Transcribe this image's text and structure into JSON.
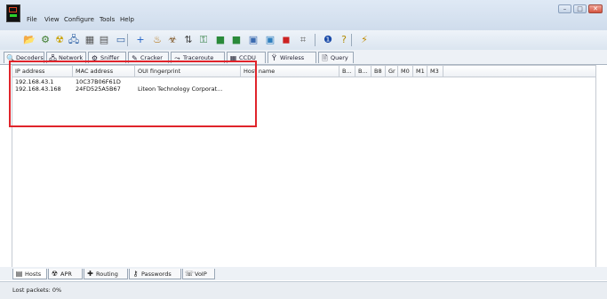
{
  "menu": [
    "File",
    "View",
    "Configure",
    "Tools",
    "Help"
  ],
  "window_controls": {
    "minimize": "–",
    "maximize": "□",
    "close": "✕"
  },
  "toolbar_icons": [
    {
      "name": "open-icon",
      "glyph": "📂",
      "color": "#d9a021"
    },
    {
      "name": "sniffer-start-icon",
      "glyph": "⚙",
      "color": "#3b7a2a"
    },
    {
      "name": "apr-icon",
      "glyph": "☢",
      "color": "#c9a100"
    },
    {
      "name": "network-icon",
      "glyph": "🖧",
      "color": "#3466a8"
    },
    {
      "name": "scan-icon",
      "glyph": "▦",
      "color": "#555"
    },
    {
      "name": "grid-icon",
      "glyph": "▤",
      "color": "#555"
    },
    {
      "name": "monitor-icon",
      "glyph": "▭",
      "color": "#2f5fa0"
    },
    {
      "name": "add-icon",
      "glyph": "+",
      "color": "#1a5cc4"
    },
    {
      "name": "hash-icon",
      "glyph": "♨",
      "color": "#b26a00"
    },
    {
      "name": "cracker-icon",
      "glyph": "☣",
      "color": "#7a4d1a"
    },
    {
      "name": "routing-icon",
      "glyph": "⇅",
      "color": "#444"
    },
    {
      "name": "certificate-icon",
      "glyph": "⚿",
      "color": "#2a7a3a"
    },
    {
      "name": "decoder-icon",
      "glyph": "■",
      "color": "#2a8a3a"
    },
    {
      "name": "voip-icon",
      "glyph": "■",
      "color": "#2a8a3a"
    },
    {
      "name": "calc-icon",
      "glyph": "▣",
      "color": "#3b6bb0"
    },
    {
      "name": "wireless-icon",
      "glyph": "▣",
      "color": "#2f7fbf"
    },
    {
      "name": "stop-icon",
      "glyph": "◼",
      "color": "#c22"
    },
    {
      "name": "query-icon",
      "glyph": "⌗",
      "color": "#666"
    },
    {
      "name": "help-icon",
      "glyph": "❶",
      "color": "#1a4aa8"
    },
    {
      "name": "question-icon",
      "glyph": "?",
      "color": "#b08a00"
    },
    {
      "name": "lightning-icon",
      "glyph": "⚡",
      "color": "#c08a00"
    }
  ],
  "top_tabs": [
    {
      "label": "Decoders",
      "icon": "decoders-icon",
      "glyph": "🔍"
    },
    {
      "label": "Network",
      "icon": "network-tab-icon",
      "glyph": "🖧"
    },
    {
      "label": "Sniffer",
      "icon": "sniffer-tab-icon",
      "glyph": "⚙"
    },
    {
      "label": "Cracker",
      "icon": "cracker-tab-icon",
      "glyph": "✎"
    },
    {
      "label": "Traceroute",
      "icon": "traceroute-tab-icon",
      "glyph": "⤳"
    },
    {
      "label": "CCDU",
      "icon": "ccdu-tab-icon",
      "glyph": "▦"
    },
    {
      "label": "Wireless",
      "icon": "wireless-tab-icon",
      "glyph": "Ÿ"
    },
    {
      "label": "Query",
      "icon": "query-tab-icon",
      "glyph": "🗎"
    }
  ],
  "table": {
    "columns": [
      "IP address",
      "MAC address",
      "OUI fingerprint",
      "Host name",
      "B...",
      "B...",
      "B8",
      "Gr",
      "M0",
      "M1",
      "M3"
    ],
    "rows": [
      [
        "192.168.43.1",
        "10C37B06F61D",
        "",
        "",
        "",
        "",
        "",
        "",
        "",
        "",
        ""
      ],
      [
        "192.168.43.168",
        "24FD525A5B67",
        "Liteon Technology Corporat...",
        "",
        "",
        "",
        "",
        "",
        "",
        "",
        ""
      ]
    ]
  },
  "bottom_tabs": [
    {
      "label": "Hosts",
      "icon": "hosts-tab-icon",
      "glyph": "▤"
    },
    {
      "label": "APR",
      "icon": "apr-tab-icon",
      "glyph": "☢"
    },
    {
      "label": "Routing",
      "icon": "routing-tab-icon",
      "glyph": "✚"
    },
    {
      "label": "Passwords",
      "icon": "passwords-tab-icon",
      "glyph": "⚷"
    },
    {
      "label": "VoIP",
      "icon": "voip-tab-icon",
      "glyph": "☏"
    }
  ],
  "status": {
    "text": "Lost packets:  0%"
  },
  "colors": {
    "highlight": "#e0242b",
    "active_tab": "#ffffff"
  }
}
